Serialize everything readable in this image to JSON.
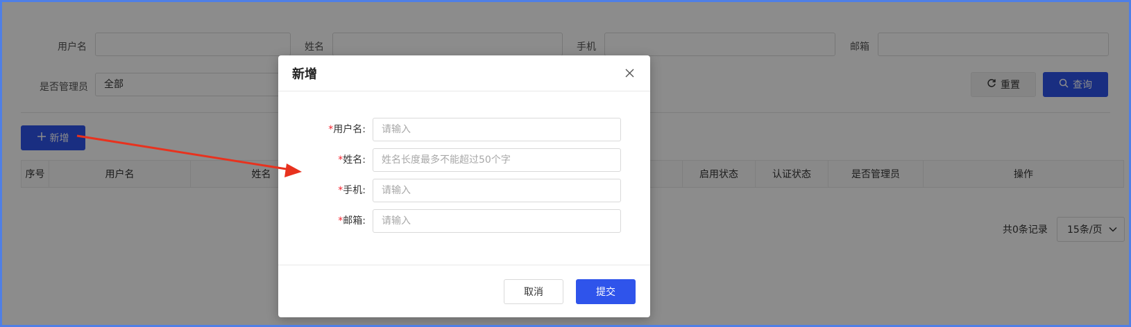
{
  "filters": {
    "username_label": "用户名",
    "name_label": "姓名",
    "phone_label": "手机",
    "email_label": "邮箱",
    "admin_label": "是否管理员",
    "admin_value": "全部",
    "reset_label": "重置",
    "search_label": "查询"
  },
  "toolbar": {
    "add_label": "新增"
  },
  "table": {
    "columns": [
      "序号",
      "用户名",
      "姓名",
      "",
      "",
      "",
      "启用状态",
      "认证状态",
      "是否管理员",
      "操作"
    ]
  },
  "pagination": {
    "total": "共0条记录",
    "page_size": "15条/页"
  },
  "dialog": {
    "title": "新增",
    "fields": [
      {
        "label": "用户名:",
        "placeholder": "请输入"
      },
      {
        "label": "姓名:",
        "placeholder": "姓名长度最多不能超过50个字"
      },
      {
        "label": "手机:",
        "placeholder": "请输入"
      },
      {
        "label": "邮箱:",
        "placeholder": "请输入"
      }
    ],
    "required_mark": "*",
    "cancel_label": "取消",
    "submit_label": "提交"
  },
  "colors": {
    "primary": "#2f54eb",
    "required": "#f5222d",
    "annotation_arrow": "#e8321e"
  },
  "icons": {
    "close": "close-icon",
    "reset": "refresh-icon",
    "search": "search-icon",
    "add": "plus-icon",
    "dropdown": "chevron-down-icon"
  }
}
